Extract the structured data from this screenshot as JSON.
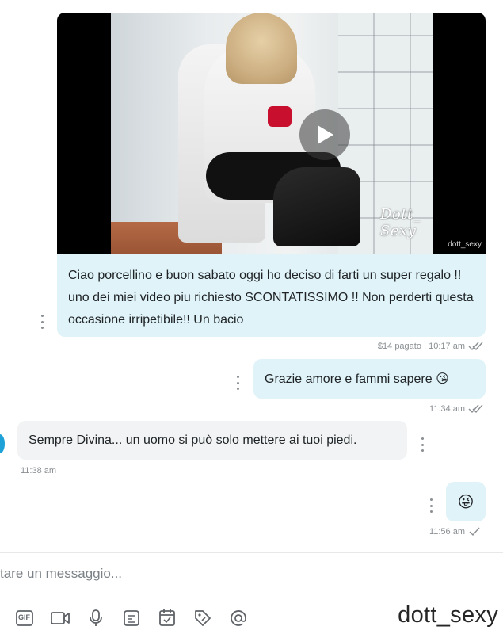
{
  "thread": {
    "video_message": {
      "watermark_script": "Dott_ Sexy",
      "handle_watermark": "dott_sexy",
      "caption": "Ciao porcellino e buon sabato oggi ho deciso di farti un super regalo !! uno dei miei video piu richiesto SCONTATISSIMO !! Non perderti questa occasione irripetibile!! Un bacio",
      "meta": "$14 pagato , 10:17 am"
    },
    "msg_out_1": {
      "text": "Grazie amore e fammi sapere 😘",
      "time": "11:34 am"
    },
    "msg_in_1": {
      "text": "Sempre Divina... un uomo si può solo mettere ai tuoi piedi.",
      "time": "11:38 am"
    },
    "msg_out_2": {
      "text": "😜",
      "time": "11:56 am"
    }
  },
  "composer": {
    "placeholder": "tare un messaggio..."
  },
  "toolbar": {
    "icons": [
      "gif-icon",
      "video-camera-icon",
      "microphone-icon",
      "poll-icon",
      "calendar-icon",
      "price-tag-icon",
      "at-sign-icon"
    ],
    "gif_label": "GIF"
  },
  "overlay": {
    "watermark": "dott_sexy"
  },
  "colors": {
    "outgoing_bubble": "#dff3f8",
    "incoming_bubble": "#f1f3f4",
    "meta_text": "#8a8f93",
    "icon": "#5f6368"
  }
}
